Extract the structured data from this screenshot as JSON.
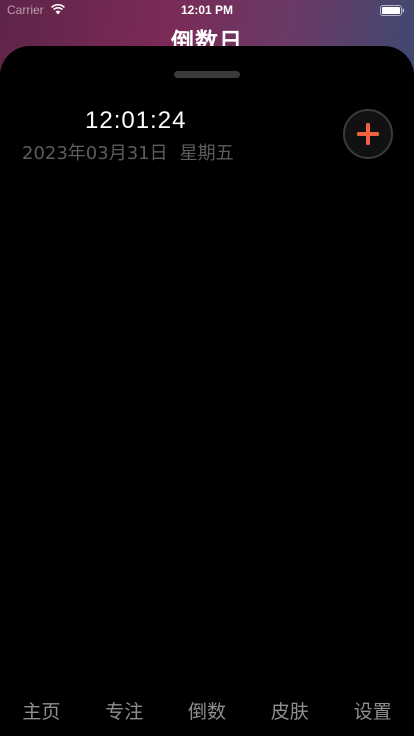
{
  "status_bar": {
    "carrier": "Carrier",
    "time": "12:01 PM"
  },
  "header": {
    "title": "倒数日"
  },
  "clock_card": {
    "time": "12:01:24",
    "date": "2023年03月31日",
    "weekday": "星期五"
  },
  "add_button": {
    "icon": "plus-icon",
    "color": "#f2613f"
  },
  "tab_bar": {
    "tabs": [
      {
        "label": "主页"
      },
      {
        "label": "专注"
      },
      {
        "label": "倒数"
      },
      {
        "label": "皮肤"
      },
      {
        "label": "设置"
      }
    ]
  }
}
